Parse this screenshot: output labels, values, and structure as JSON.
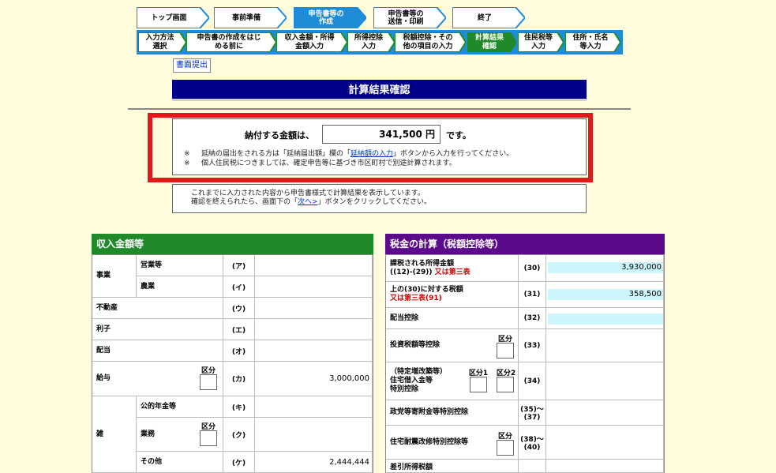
{
  "steps": [
    {
      "label": "トップ画面",
      "state": "done"
    },
    {
      "label": "事前準備",
      "state": "done"
    },
    {
      "label": "申告書等の作成",
      "state": "active"
    },
    {
      "label": "申告書等の送信・印刷",
      "state": "todo"
    },
    {
      "label": "終了",
      "state": "todo"
    }
  ],
  "substeps": [
    {
      "label": "入力方法選択",
      "state": "done"
    },
    {
      "label": "申告書の作成をはじめる前に",
      "state": "done"
    },
    {
      "label": "収入金額・所得金額入力",
      "state": "done"
    },
    {
      "label": "所得控除入力",
      "state": "done"
    },
    {
      "label": "税額控除・その他の項目の入力",
      "state": "done"
    },
    {
      "label": "計算結果確認",
      "state": "active"
    },
    {
      "label": "住民税等入力",
      "state": "todo"
    },
    {
      "label": "住所・氏名等入力",
      "state": "todo"
    }
  ],
  "step_labels": {
    "s0": "トップ画面",
    "s1": "事前準備",
    "s2a": "申告書等の",
    "s2b": "作成",
    "s3a": "申告書等の",
    "s3b": "送信・印刷",
    "s4": "終了",
    "u0a": "入力方法",
    "u0b": "選択",
    "u1a": "申告書の作成をはじ",
    "u1b": "める前に",
    "u2a": "収入金額・所得",
    "u2b": "金額入力",
    "u3a": "所得控除",
    "u3b": "入力",
    "u4a": "税額控除・その",
    "u4b": "他の項目の入力",
    "u5a": "計算結果",
    "u5b": "確認",
    "u6a": "住民税等",
    "u6b": "入力",
    "u7a": "住所・氏名",
    "u7b": "等入力"
  },
  "shomen_button": "書面提出",
  "page_title": "計算結果確認",
  "payment": {
    "prefix": "納付する金額は、",
    "amount": "341,500 円",
    "suffix": "です。",
    "note1_pre": "延納の届出をされる方は「延納届出額」欄の「",
    "note1_link": "延納額の入力",
    "note1_post": "」ボタンから入力を行ってください。",
    "note2": "個人住民税につきましては、確定申告等に基づき市区町村で別途計算されます。",
    "mark": "※"
  },
  "info": {
    "line1": "これまでに入力された内容から申告書様式で計算結果を表示しています。",
    "line2_pre": "確認を終えられたら、画面下の「",
    "line2_link": "次へ>",
    "line2_post": "」ボタンをクリックしてください。"
  },
  "income": {
    "title": "収入金額等",
    "kubun": "区分",
    "rows": {
      "jigyo": "事業",
      "eigyo": "営業等",
      "eigyo_code": "(ア)",
      "nogyo": "農業",
      "nogyo_code": "(イ)",
      "fudosan": "不動産",
      "fudosan_code": "(ウ)",
      "rishi": "利子",
      "rishi_code": "(エ)",
      "haito": "配当",
      "haito_code": "(オ)",
      "kyuyo": "給与",
      "kyuyo_code": "(カ)",
      "kyuyo_val": "3,000,000",
      "zatsu": "雑",
      "nenkin": "公的年金等",
      "nenkin_code": "(キ)",
      "gyomu": "業務",
      "gyomu_code": "(ク)",
      "sonota": "その他",
      "sonota_code": "(ケ)",
      "sonota_val": "2,444,444"
    }
  },
  "tax": {
    "title": "税金の計算（税額控除等）",
    "kubun": "区分",
    "kubun1": "区分1",
    "kubun2": "区分2",
    "rows": {
      "r30a": "課税される所得金額",
      "r30b": "((12)-(29))",
      "r30c": "又は第三表",
      "r30_code": "(30)",
      "r30_val": "3,930,000",
      "r31a": "上の(30)に対する税額",
      "r31b": "又は第三表(91)",
      "r31_code": "(31)",
      "r31_val": "358,500",
      "r32": "配当控除",
      "r32_code": "(32)",
      "r33": "投資税額等控除",
      "r33_code": "(33)",
      "r34a": "（特定増改築等）",
      "r34b": "住宅借入金等",
      "r34c": "特別控除",
      "r34_code": "(34)",
      "r35": "政党等寄附金等特別控除",
      "r35_code_a": "(35)～",
      "r35_code_b": "(37)",
      "r38": "住宅耐震改修特別控除等",
      "r38_code_a": "(38)～",
      "r38_code_b": "(40)",
      "r41": "差引所得税額"
    }
  },
  "colors": {
    "bg": "#fefcdc",
    "step_active": "#1f8cd8",
    "green": "#208a2a",
    "purple": "#5a0a8a",
    "navy": "#000088",
    "alert": "#e01a1a",
    "cyan": "#ccf6fc"
  }
}
